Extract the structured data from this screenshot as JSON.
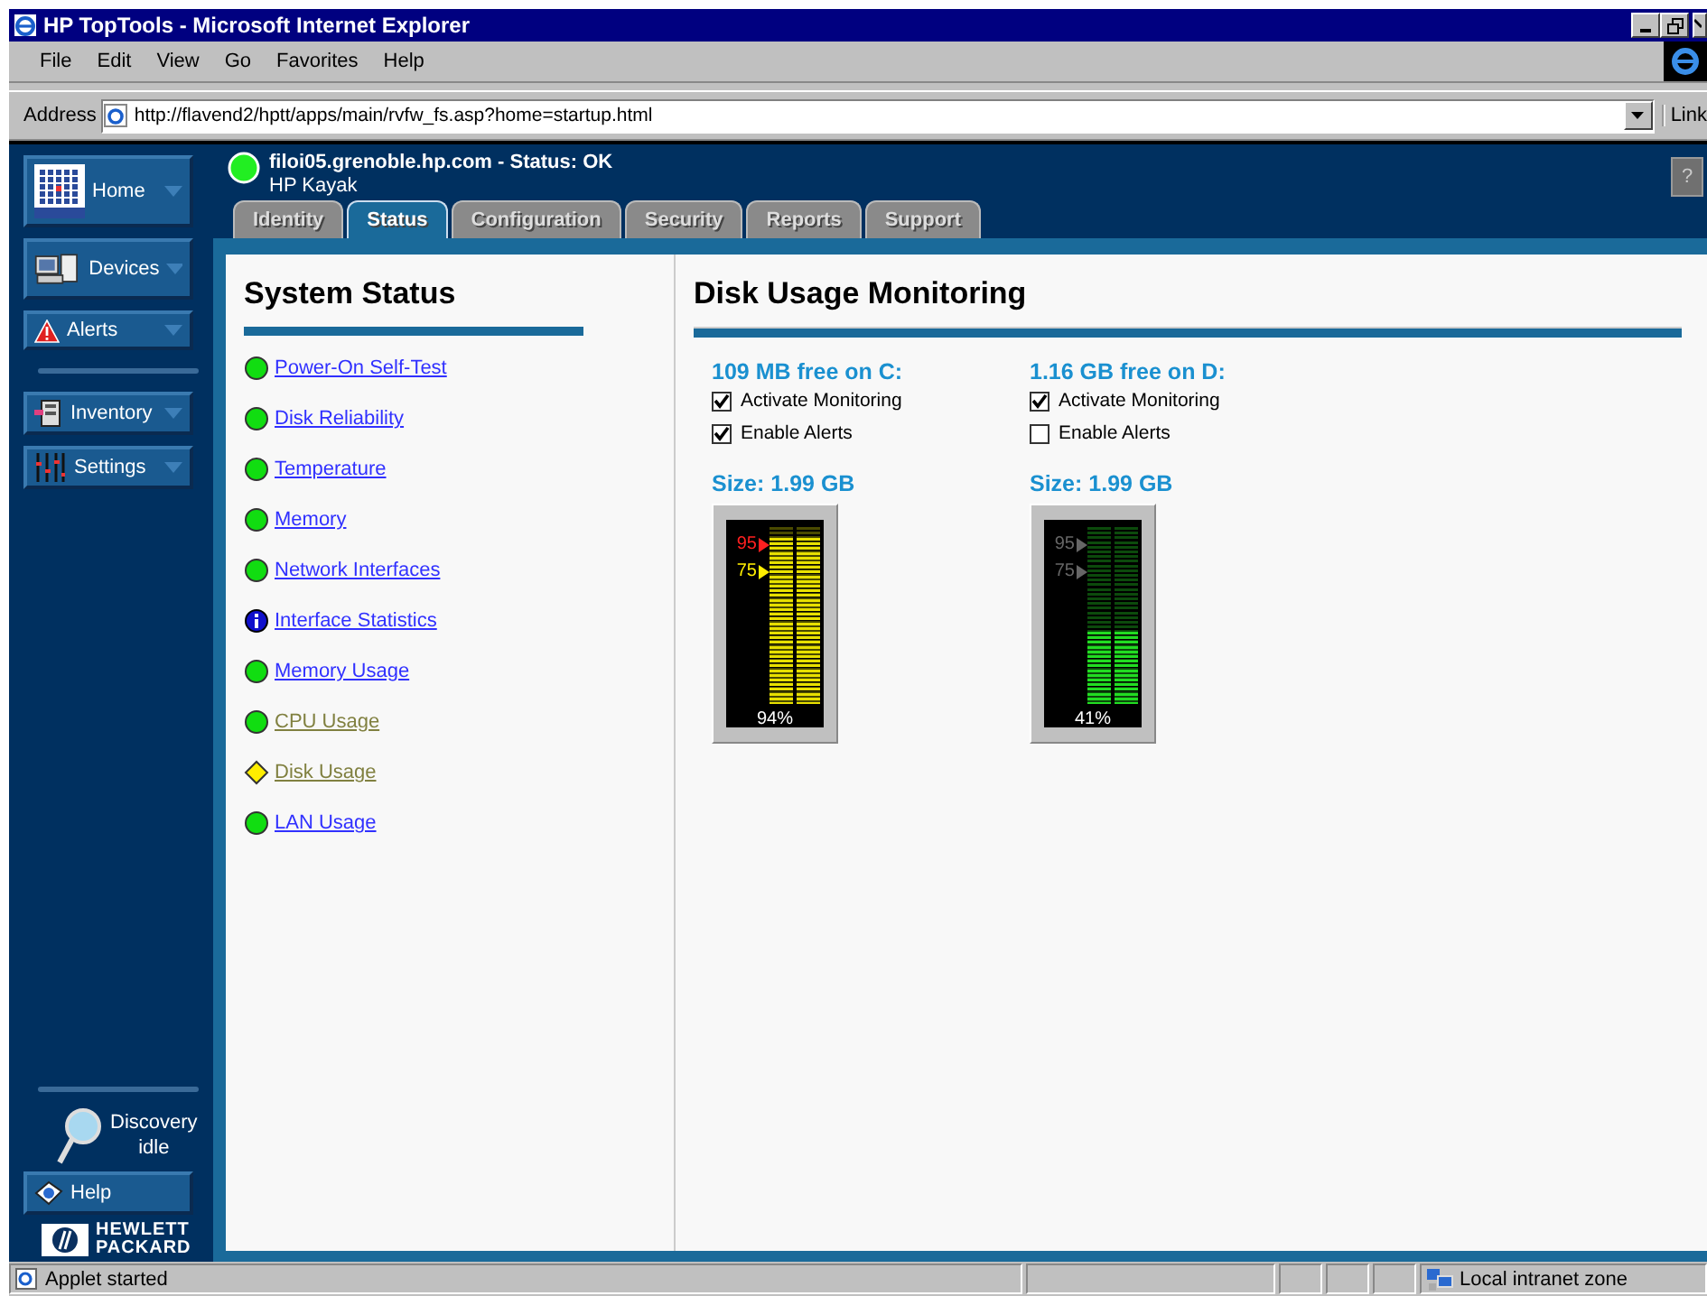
{
  "window": {
    "title": "HP TopTools - Microsoft Internet Explorer"
  },
  "menu": [
    "File",
    "Edit",
    "View",
    "Go",
    "Favorites",
    "Help"
  ],
  "address": {
    "label": "Address",
    "url": "http://flavend2/hptt/apps/main/rvfw_fs.asp?home=startup.html",
    "links": "Link"
  },
  "sidebar": {
    "items": [
      {
        "label": "Home"
      },
      {
        "label": "Devices"
      },
      {
        "label": "Alerts"
      },
      {
        "label": "Inventory"
      },
      {
        "label": "Settings"
      }
    ],
    "discovery": [
      "Discovery",
      "idle"
    ],
    "help": "Help",
    "logo": [
      "HEWLETT",
      "PACKARD"
    ]
  },
  "header": {
    "host": "filoi05.grenoble.hp.com - Status: OK",
    "model": "HP Kayak",
    "help_button": "?"
  },
  "tabs": [
    {
      "label": "Identity",
      "selected": false
    },
    {
      "label": "Status",
      "selected": true
    },
    {
      "label": "Configuration",
      "selected": false
    },
    {
      "label": "Security",
      "selected": false
    },
    {
      "label": "Reports",
      "selected": false
    },
    {
      "label": "Support",
      "selected": false
    }
  ],
  "system_status": {
    "title": "System Status",
    "items": [
      {
        "label": "Power-On Self-Test",
        "kind": "ok",
        "visited": false
      },
      {
        "label": "Disk Reliability",
        "kind": "ok",
        "visited": false
      },
      {
        "label": "Temperature",
        "kind": "ok",
        "visited": false
      },
      {
        "label": "Memory",
        "kind": "ok",
        "visited": false
      },
      {
        "label": "Network Interfaces",
        "kind": "ok",
        "visited": false
      },
      {
        "label": "Interface Statistics",
        "kind": "info",
        "visited": false
      },
      {
        "label": "Memory Usage",
        "kind": "ok",
        "visited": false
      },
      {
        "label": "CPU Usage",
        "kind": "ok",
        "visited": true
      },
      {
        "label": "Disk Usage",
        "kind": "warning",
        "visited": true
      },
      {
        "label": "LAN Usage",
        "kind": "ok",
        "visited": false
      }
    ]
  },
  "disk_usage": {
    "title": "Disk Usage Monitoring",
    "disks": [
      {
        "free": "109 MB free on C:",
        "options": [
          {
            "label": "Activate Monitoring",
            "checked": true
          },
          {
            "label": "Enable Alerts",
            "checked": true
          }
        ],
        "size": "Size: 1.99 GB",
        "level": 0.94,
        "reading": "94%",
        "alerting": true,
        "thresholds": [
          "95",
          "75"
        ]
      },
      {
        "free": "1.16 GB free on D:",
        "options": [
          {
            "label": "Activate Monitoring",
            "checked": true
          },
          {
            "label": "Enable Alerts",
            "checked": false
          }
        ],
        "size": "Size: 1.99 GB",
        "level": 0.41,
        "reading": "41%",
        "alerting": false,
        "thresholds": [
          "95",
          "75"
        ]
      }
    ]
  },
  "status_bar": {
    "text": "Applet started",
    "zone": "Local intranet zone"
  }
}
